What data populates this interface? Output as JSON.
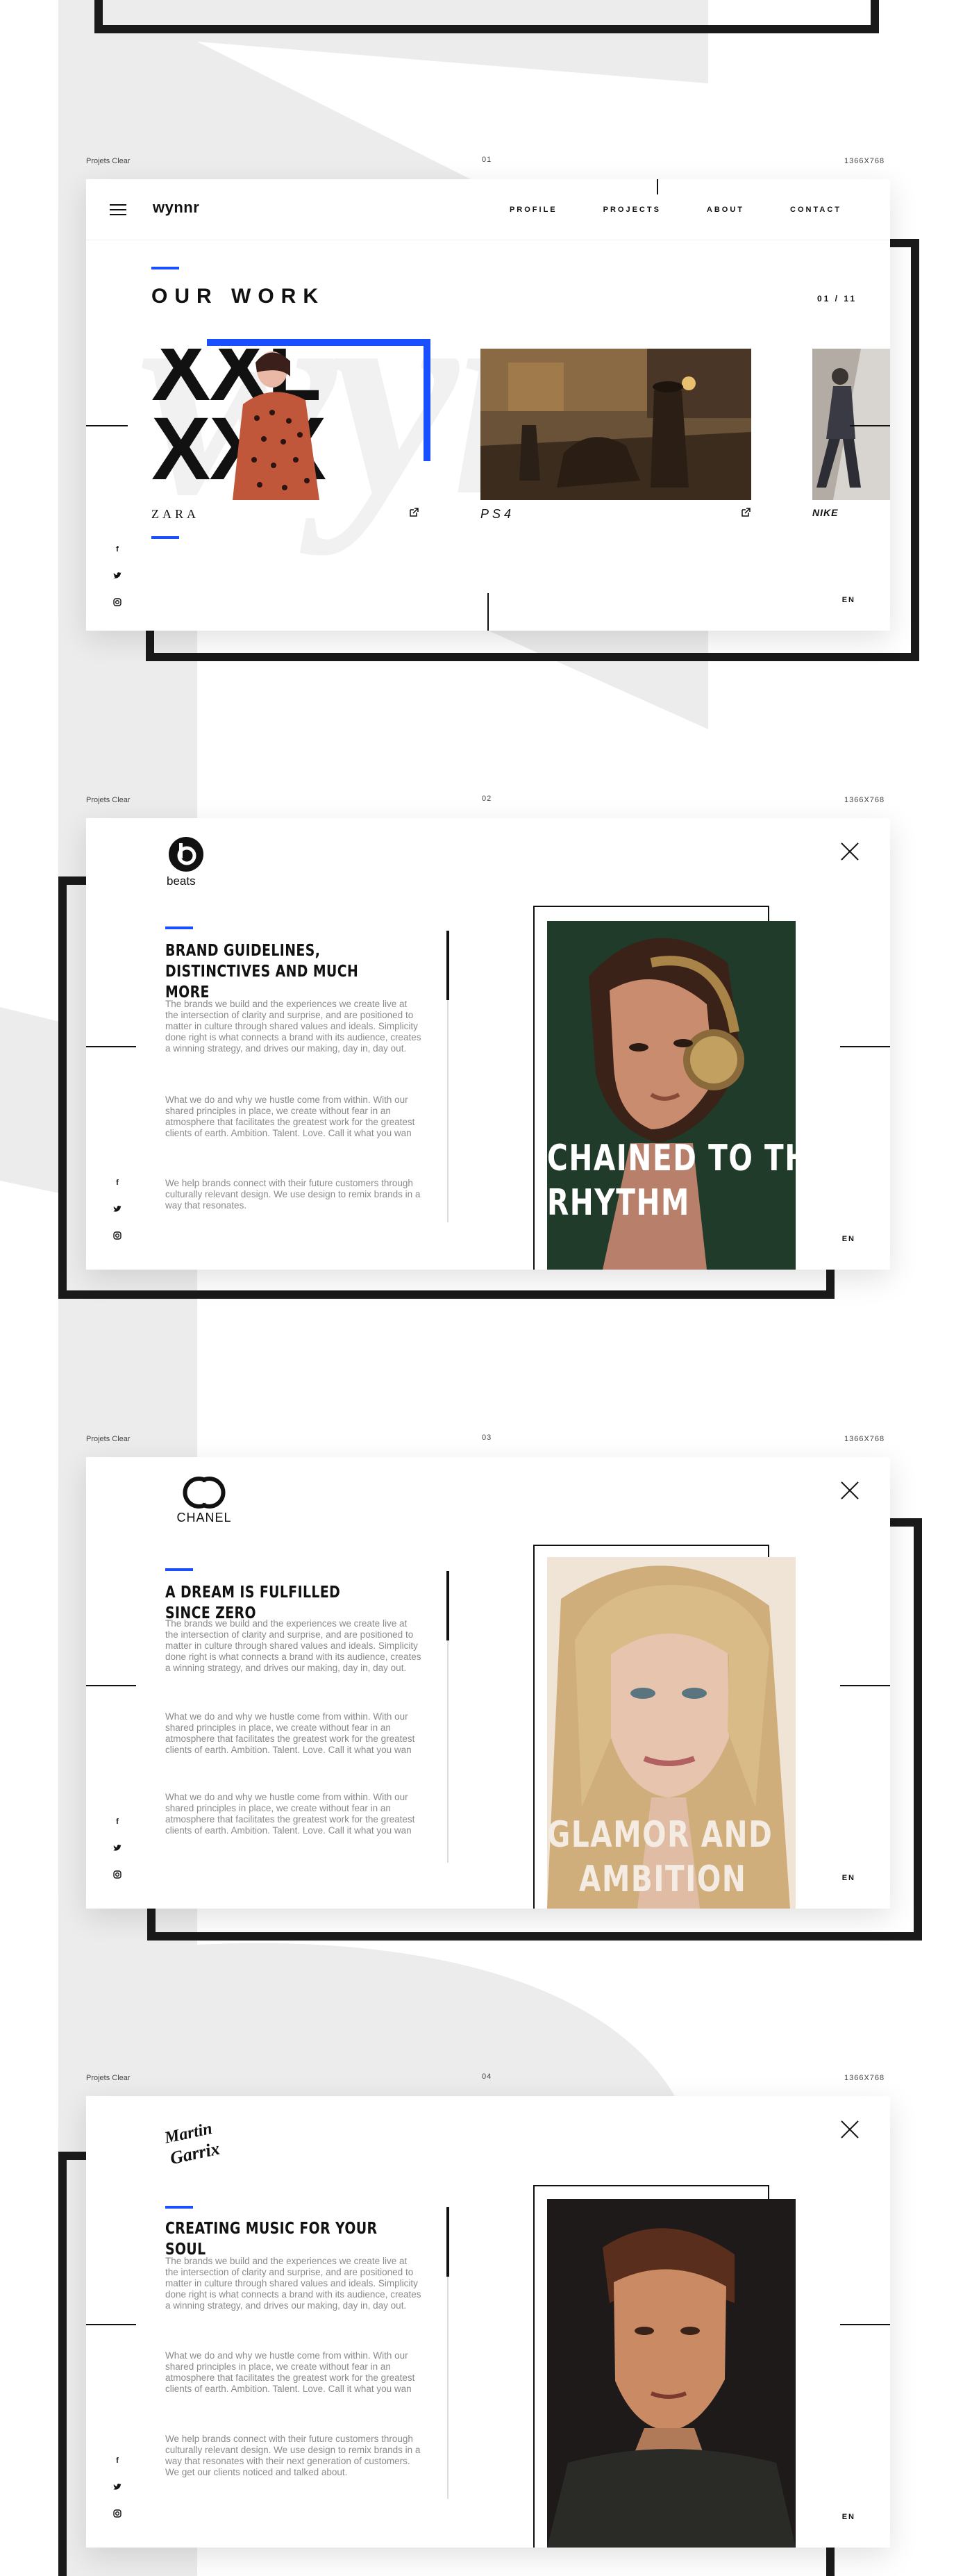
{
  "sections": [
    {
      "meta_left": "Projets Clear",
      "meta_num": "01",
      "meta_res": "1366X768"
    },
    {
      "meta_left": "Projets Clear",
      "meta_num": "02",
      "meta_res": "1366X768"
    },
    {
      "meta_left": "Projets Clear",
      "meta_num": "03",
      "meta_res": "1366X768"
    },
    {
      "meta_left": "Projets Clear",
      "meta_num": "04",
      "meta_res": "1366X768"
    }
  ],
  "home": {
    "brand": "wynnr",
    "nav": [
      "PROFILE",
      "PROJECTS",
      "ABOUT",
      "CONTACT"
    ],
    "watermark": "wynr",
    "title": "OUR WORK",
    "pager": "01 / 11",
    "projects": [
      {
        "logo": "ZARA",
        "big_letters_top": "XXL",
        "big_letters_bottom": "XXX"
      },
      {
        "logo": "PS4"
      },
      {
        "logo": "NIKE"
      }
    ],
    "lang": "EN"
  },
  "details": [
    {
      "brand_logo": "beats",
      "title": "BRAND GUIDELINES, DISTINCTIVES AND MUCH MORE",
      "paragraphs": [
        "The brands we build and the experiences we create live at the intersection of clarity and surprise, and are positioned to matter in culture through shared values and ideals. Simplicity done right is what connects a brand with its audience, creates a winning strategy, and drives our making, day in, day out.",
        "What we do and why we hustle come from within. With our shared principles in place, we create without fear in an atmosphere that facilitates the greatest work for the greatest clients of earth. Ambition. Talent. Love. Call it what you wan",
        "We help brands connect with their future customers through culturally relevant design. We use design to remix brands in a way that resonates."
      ],
      "caption": [
        "CHAINED TO THE",
        "RHYTHM"
      ],
      "lang": "EN"
    },
    {
      "brand_logo": "CHANEL",
      "title": "A DREAM IS FULFILLED SINCE ZERO",
      "paragraphs": [
        "The brands we build and the experiences we create live at the intersection of clarity and surprise, and are positioned to matter in culture through shared values and ideals. Simplicity done right is what connects a brand with its audience, creates a winning strategy, and drives our making, day in, day out.",
        "What we do and why we hustle come from within. With our shared principles in place, we create without fear in an atmosphere that facilitates the greatest work for the greatest clients of earth. Ambition. Talent. Love. Call it what you wan",
        "What we do and why we hustle come from within. With our shared principles in place, we create without fear in an atmosphere that facilitates the greatest work for the greatest clients of earth. Ambition. Talent. Love. Call it what you wan"
      ],
      "caption": [
        "GLAMOR AND",
        "AMBITION"
      ],
      "lang": "EN"
    },
    {
      "brand_logo": "MARTIN GARRIX",
      "title": "CREATING MUSIC FOR YOUR SOUL",
      "paragraphs": [
        "The brands we build and the experiences we create live at the intersection of clarity and surprise, and are positioned to matter in culture through shared values and ideals. Simplicity done right is what connects a brand with its audience, creates a winning strategy, and drives our making, day in, day out.",
        "What we do and why we hustle come from within. With our shared principles in place, we create without fear in an atmosphere that facilitates the greatest work for the greatest clients of earth. Ambition. Talent. Love. Call it what you wan",
        "We help brands connect with their future customers through culturally relevant design. We use design to remix brands in a way that resonates with their next generation of customers. We get our clients noticed and talked about."
      ],
      "caption": [],
      "lang": "EN"
    }
  ],
  "social_icons": [
    "facebook-icon",
    "twitter-icon",
    "instagram-icon"
  ],
  "colors": {
    "accent": "#1a4fff",
    "frame": "#1a1a1a",
    "bg_shape": "#ececec"
  }
}
